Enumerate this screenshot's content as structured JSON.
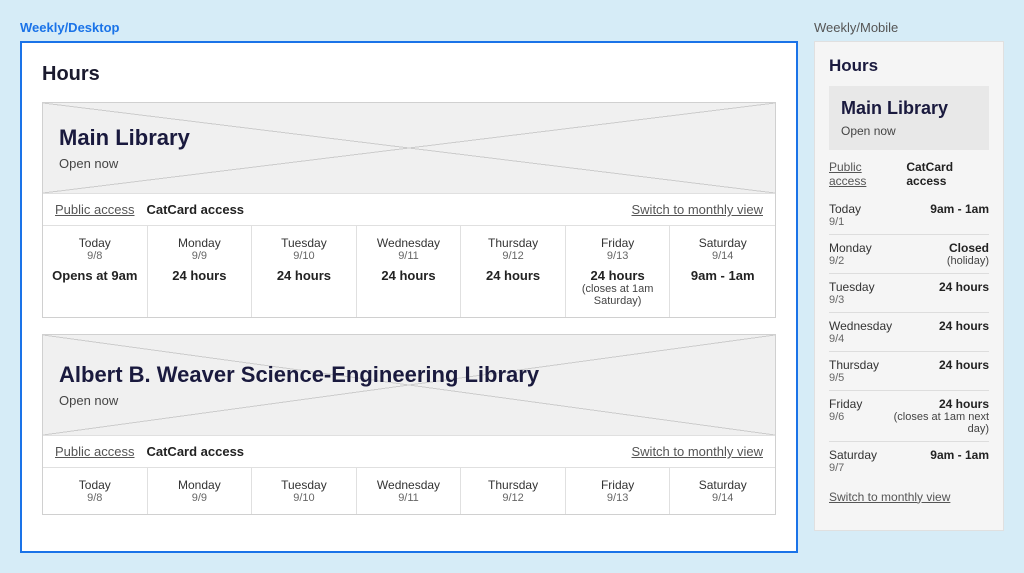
{
  "left_panel_label": "Weekly/Desktop",
  "right_panel_label": "Weekly/Mobile",
  "page_title": "Hours",
  "libraries": [
    {
      "name": "Main Library",
      "status": "Open now",
      "tabs": [
        {
          "label": "Public access",
          "active": false
        },
        {
          "label": "CatCard access",
          "active": true
        }
      ],
      "switch_view_label": "Switch to monthly view",
      "days": [
        {
          "name": "Today",
          "date": "9/8",
          "hours": "Opens at 9am",
          "note": ""
        },
        {
          "name": "Monday",
          "date": "9/9",
          "hours": "24 hours",
          "note": ""
        },
        {
          "name": "Tuesday",
          "date": "9/10",
          "hours": "24 hours",
          "note": ""
        },
        {
          "name": "Wednesday",
          "date": "9/11",
          "hours": "24 hours",
          "note": ""
        },
        {
          "name": "Thursday",
          "date": "9/12",
          "hours": "24 hours",
          "note": ""
        },
        {
          "name": "Friday",
          "date": "9/13",
          "hours": "24 hours",
          "note": "(closes at 1am Saturday)"
        },
        {
          "name": "Saturday",
          "date": "9/14",
          "hours": "9am - 1am",
          "note": ""
        }
      ]
    },
    {
      "name": "Albert B. Weaver Science-Engineering Library",
      "status": "Open now",
      "tabs": [
        {
          "label": "Public access",
          "active": false
        },
        {
          "label": "CatCard access",
          "active": true
        }
      ],
      "switch_view_label": "Switch to monthly view",
      "days": [
        {
          "name": "Today",
          "date": "9/8",
          "hours": "",
          "note": ""
        },
        {
          "name": "Monday",
          "date": "9/9",
          "hours": "",
          "note": ""
        },
        {
          "name": "Tuesday",
          "date": "9/10",
          "hours": "",
          "note": ""
        },
        {
          "name": "Wednesday",
          "date": "9/11",
          "hours": "",
          "note": ""
        },
        {
          "name": "Thursday",
          "date": "9/12",
          "hours": "",
          "note": ""
        },
        {
          "name": "Friday",
          "date": "9/13",
          "hours": "",
          "note": ""
        },
        {
          "name": "Saturday",
          "date": "9/14",
          "hours": "",
          "note": ""
        }
      ]
    }
  ],
  "mobile": {
    "title": "Hours",
    "library_name": "Main Library",
    "library_status": "Open now",
    "tabs": [
      {
        "label": "Public access",
        "active": false
      },
      {
        "label": "CatCard access",
        "active": true
      }
    ],
    "days": [
      {
        "name": "Today",
        "date": "9/1",
        "hours": "9am - 1am",
        "note": ""
      },
      {
        "name": "Monday",
        "date": "9/2",
        "hours": "Closed",
        "note": "(holiday)"
      },
      {
        "name": "Tuesday",
        "date": "9/3",
        "hours": "24 hours",
        "note": ""
      },
      {
        "name": "Wednesday",
        "date": "9/4",
        "hours": "24 hours",
        "note": ""
      },
      {
        "name": "Thursday",
        "date": "9/5",
        "hours": "24 hours",
        "note": ""
      },
      {
        "name": "Friday",
        "date": "9/6",
        "hours": "24 hours",
        "note": "(closes at 1am next day)"
      },
      {
        "name": "Saturday",
        "date": "9/7",
        "hours": "9am - 1am",
        "note": ""
      }
    ],
    "switch_view_label": "Switch to monthly view"
  }
}
